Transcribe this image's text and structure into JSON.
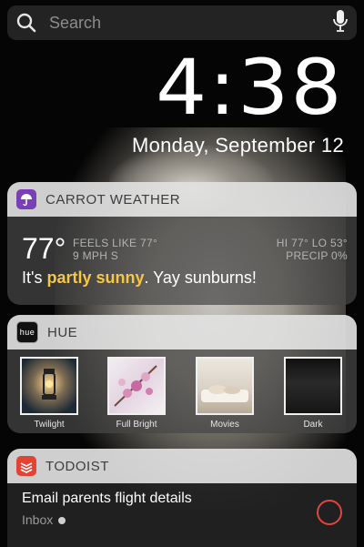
{
  "search": {
    "placeholder": "Search"
  },
  "clock": {
    "time": "4:38",
    "date": "Monday, September 12"
  },
  "weather": {
    "app_name": "CARROT WEATHER",
    "temp": "77°",
    "feels_like": "FEELS LIKE 77°",
    "wind": "9 MPH S",
    "hi_lo": "HI 77° LO 53°",
    "precip": "PRECIP 0%",
    "summary_pre": "It's ",
    "summary_highlight": "partly sunny",
    "summary_post": ". Yay sunburns!",
    "accent": "#f6c744",
    "icon_color": "#7a3fb7"
  },
  "hue": {
    "app_name": "HUE",
    "icon_text": "hue",
    "scenes": [
      {
        "label": "Twilight",
        "icon": "lantern"
      },
      {
        "label": "Full Bright",
        "icon": "blossom"
      },
      {
        "label": "Movies",
        "icon": "bed"
      },
      {
        "label": "Dark",
        "icon": "dark"
      }
    ]
  },
  "todoist": {
    "app_name": "TODOIST",
    "task": "Email parents flight details",
    "project": "Inbox",
    "icon_color": "#e44232",
    "check_color": "#e2453b"
  }
}
